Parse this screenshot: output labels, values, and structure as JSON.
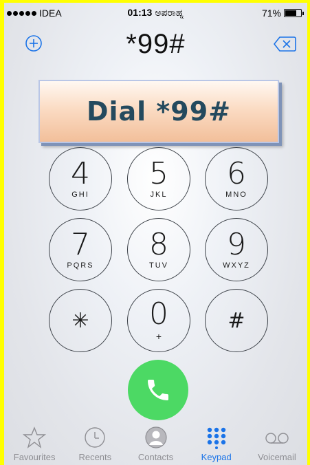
{
  "status": {
    "carrier": "IDEA",
    "time": "01:13",
    "time_suffix": "ಅಪರಾಹ್ನ",
    "battery": "71%",
    "battery_level": 0.71
  },
  "dialer": {
    "number": "*99#"
  },
  "banner": {
    "text": "Dial *99#"
  },
  "keys": [
    {
      "digit": "4",
      "letters": "GHI"
    },
    {
      "digit": "5",
      "letters": "JKL"
    },
    {
      "digit": "6",
      "letters": "MNO"
    },
    {
      "digit": "7",
      "letters": "PQRS"
    },
    {
      "digit": "8",
      "letters": "TUV"
    },
    {
      "digit": "9",
      "letters": "WXYZ"
    },
    {
      "digit": "*",
      "letters": ""
    },
    {
      "digit": "0",
      "letters": "+"
    },
    {
      "digit": "#",
      "letters": ""
    }
  ],
  "tabs": [
    {
      "label": "Favourites",
      "icon": "star-icon"
    },
    {
      "label": "Recents",
      "icon": "clock-icon"
    },
    {
      "label": "Contacts",
      "icon": "person-icon"
    },
    {
      "label": "Keypad",
      "icon": "keypad-icon",
      "active": true
    },
    {
      "label": "Voicemail",
      "icon": "voicemail-icon"
    }
  ],
  "colors": {
    "accent": "#1a73e8",
    "call_green": "#4cd964",
    "banner_text": "#244a5e"
  }
}
